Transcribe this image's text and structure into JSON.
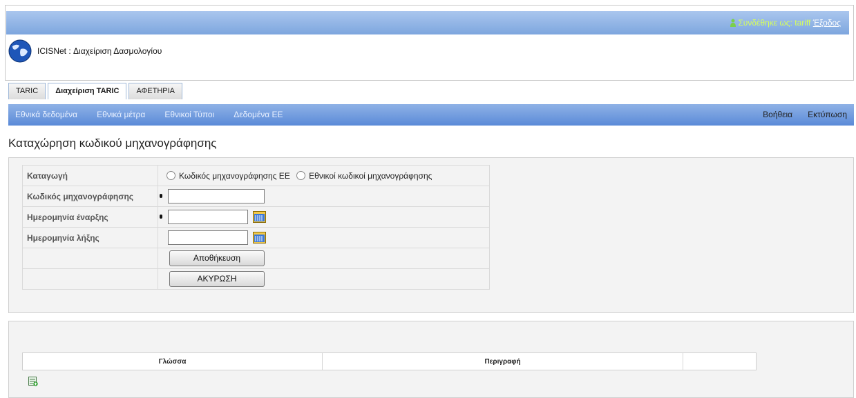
{
  "header": {
    "logged_in_label": "Συνδέθηκε ως: tariff",
    "logout_label": "Έξοδος",
    "app_title": "ICISNet : Διαχείριση Δασμολογίου"
  },
  "tabs": [
    {
      "label": "TARIC"
    },
    {
      "label": "Διαχείριση TARIC"
    },
    {
      "label": "ΑΦΕΤΗΡΙΑ"
    }
  ],
  "nav": {
    "left": [
      {
        "label": "Εθνικά δεδομένα"
      },
      {
        "label": "Εθνικά μέτρα"
      },
      {
        "label": "Εθνικοί Τύποι"
      },
      {
        "label": "Δεδομένα ΕΕ"
      }
    ],
    "right": [
      {
        "label": "Βοήθεια"
      },
      {
        "label": "Εκτύπωση"
      }
    ]
  },
  "page_title": "Καταχώρηση κωδικού μηχανογράφησης",
  "form": {
    "origin_label": "Καταγωγή",
    "origin_option_eu": "Κωδικός μηχανογράφησης ΕΕ",
    "origin_option_national": "Εθνικοί κωδικοί μηχανογράφησης",
    "code_label": "Κωδικός μηχανογράφησης",
    "code_value": "",
    "start_date_label": "Ημερομηνία έναρξης",
    "start_date_value": "",
    "end_date_label": "Ημερομηνία λήξης",
    "end_date_value": "",
    "save_label": "Αποθήκευση",
    "cancel_label": "ΑΚΥΡΩΣΗ"
  },
  "grid": {
    "columns": [
      "Γλώσσα",
      "Περιγραφή",
      ""
    ]
  },
  "icons": {
    "user": "user-icon",
    "logo": "globe-icon",
    "calendar": "calendar-icon",
    "add_row": "add-row-icon"
  },
  "colors": {
    "header_bar": "#7da6de",
    "navbar": "#5a8ad8",
    "logged_in_text": "#d7ff5a"
  }
}
